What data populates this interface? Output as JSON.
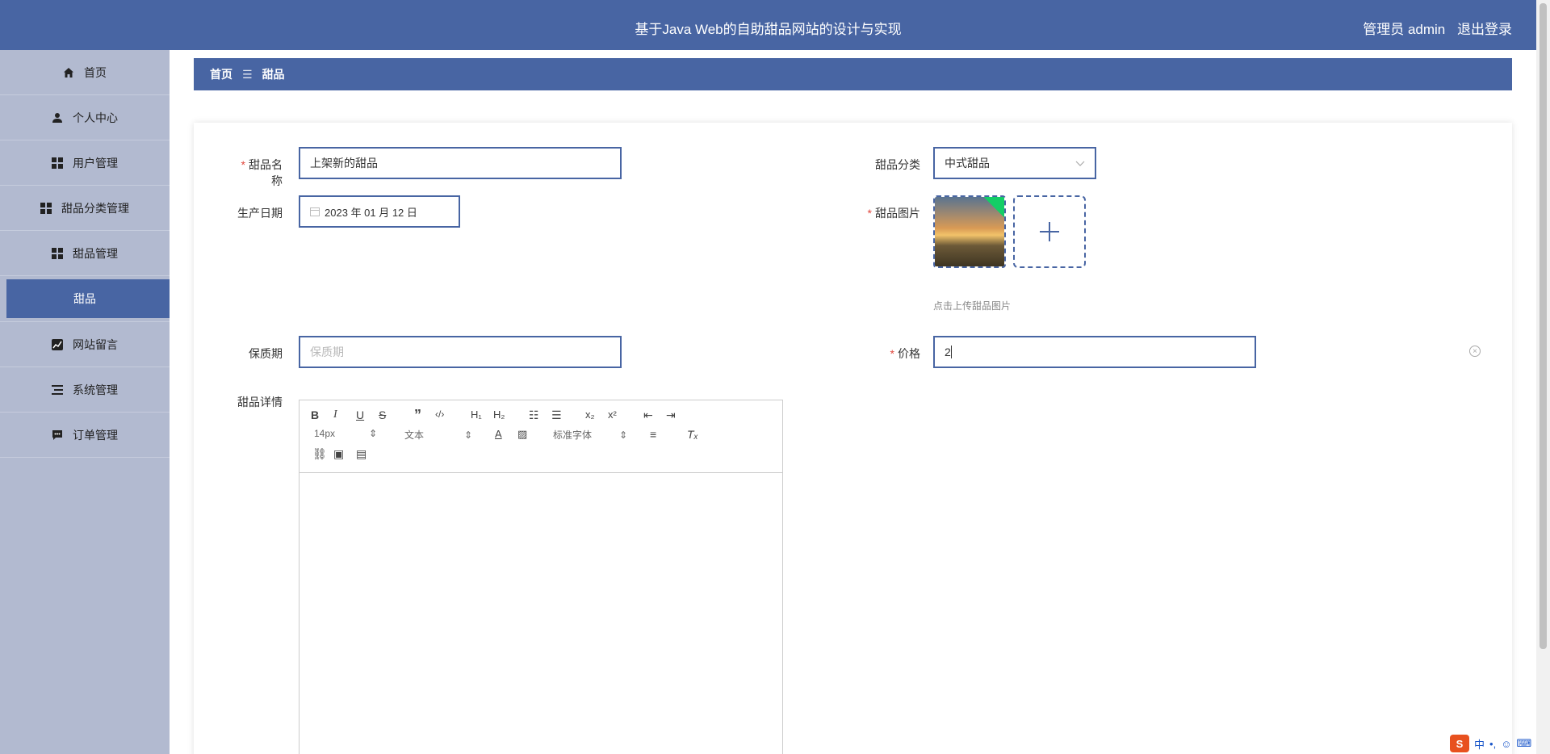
{
  "header": {
    "title": "基于Java Web的自助甜品网站的设计与实现",
    "user_label": "管理员 admin",
    "logout_label": "退出登录"
  },
  "sidebar": {
    "items": [
      {
        "label": "首页",
        "icon": "home-icon"
      },
      {
        "label": "个人中心",
        "icon": "user-icon"
      },
      {
        "label": "用户管理",
        "icon": "grid-icon"
      },
      {
        "label": "甜品分类管理",
        "icon": "grid-icon"
      },
      {
        "label": "甜品管理",
        "icon": "grid-icon"
      },
      {
        "label": "甜品",
        "icon": "",
        "active": true
      },
      {
        "label": "网站留言",
        "icon": "chart-icon"
      },
      {
        "label": "系统管理",
        "icon": "list-icon"
      },
      {
        "label": "订单管理",
        "icon": "chat-icon"
      }
    ]
  },
  "breadcrumb": {
    "home": "首页",
    "separator": "☰",
    "current": "甜品"
  },
  "form": {
    "name_label": "甜品名称",
    "name_value": "上架新的甜品",
    "category_label": "甜品分类",
    "category_value": "中式甜品",
    "date_label": "生产日期",
    "date_value": "2023 年 01 月 12 日",
    "image_label": "甜品图片",
    "image_hint": "点击上传甜品图片",
    "shelf_label": "保质期",
    "shelf_placeholder": "保质期",
    "price_label": "价格",
    "price_value": "2",
    "detail_label": "甜品详情",
    "required_mark": "*"
  },
  "editor": {
    "font_size": "14px",
    "format": "文本",
    "font_family": "标准字体"
  },
  "ime": {
    "label": "中"
  },
  "colors": {
    "primary": "#4865a3",
    "sidebar": "#b2bad0",
    "required": "#e0473d",
    "success": "#13ce66"
  }
}
